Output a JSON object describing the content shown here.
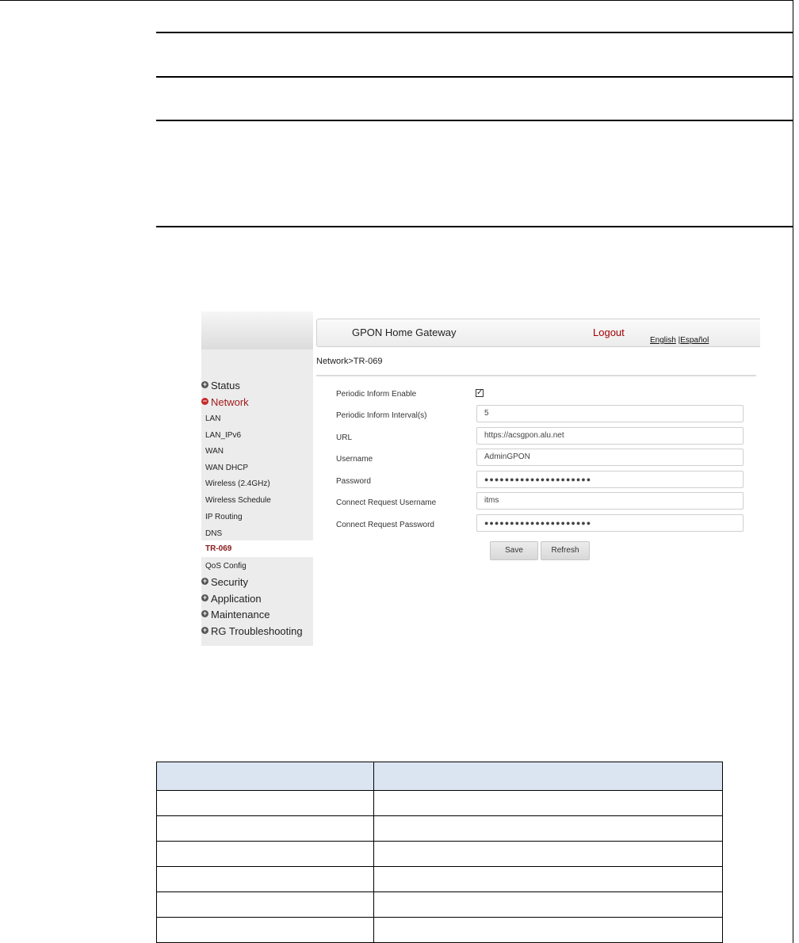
{
  "app": {
    "brand": "GPON Home Gateway",
    "logout": "Logout",
    "lang_english": "English",
    "lang_sep": " |",
    "lang_espanol": "Español",
    "accent_color": "#a30000"
  },
  "breadcrumb": "Network>TR-069",
  "sidebar": {
    "status": "Status",
    "network": "Network",
    "network_items": [
      "LAN",
      "LAN_IPv6",
      "WAN",
      "WAN DHCP",
      "Wireless (2.4GHz)",
      "Wireless Schedule",
      "IP Routing",
      "DNS",
      "TR-069",
      "QoS Config"
    ],
    "security": "Security",
    "application": "Application",
    "maintenance": "Maintenance",
    "rg_troubleshooting": "RG Troubleshooting"
  },
  "form": {
    "periodic_enable_label": "Periodic Inform Enable",
    "periodic_enable_checked": "✓",
    "interval_label": "Periodic Inform Interval(s)",
    "interval_value": "5",
    "url_label": "URL",
    "url_value": "https://acsgpon.alu.net",
    "username_label": "Username",
    "username_value": "AdminGPON",
    "password_label": "Password",
    "password_value": "●●●●●●●●●●●●●●●●●●●●●",
    "cr_username_label": "Connect Request Username",
    "cr_username_value": "itms",
    "cr_password_label": "Connect Request Password",
    "cr_password_value": "●●●●●●●●●●●●●●●●●●●●●",
    "save": "Save",
    "refresh": "Refresh"
  }
}
